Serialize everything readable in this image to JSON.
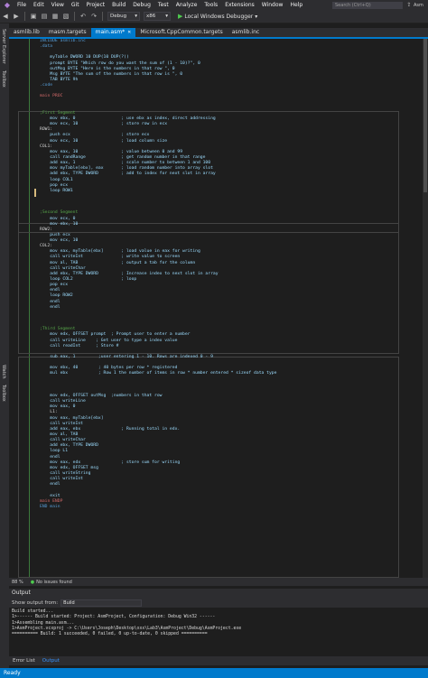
{
  "menu": {
    "items": [
      "File",
      "Edit",
      "View",
      "Git",
      "Project",
      "Build",
      "Debug",
      "Test",
      "Analyze",
      "Tools",
      "Extensions",
      "Window",
      "Help"
    ],
    "search_placeholder": "Search (Ctrl+Q)",
    "user": "Asm"
  },
  "toolbar": {
    "config": "Debug",
    "platform": "x86",
    "run_label": "Local Windows Debugger"
  },
  "sidebar": {
    "upper_tabs": [
      "Server Explorer",
      "Toolbox"
    ],
    "lower_tabs": [
      "Watch",
      "Toolbox"
    ]
  },
  "tabs": [
    {
      "label": "asmlib.lib",
      "active": false
    },
    {
      "label": "masm.targets",
      "active": false
    },
    {
      "label": "main.asm*",
      "active": true
    },
    {
      "label": "Microsoft.CppCommon.targets",
      "active": false
    },
    {
      "label": "asmlib.inc",
      "active": false
    }
  ],
  "code": [
    "INCLUDE asmlib.inc",
    ".data",
    "",
    "    myTable DWORD 10 DUP(10 DUP(?))",
    "    prompt BYTE \"Which row do you want the sum of (1 - 10)?\", 0",
    "    outMsg BYTE \"Here is the numbers in that row \", 0",
    "    Msg BYTE \"The sum of the numbers in that row is \", 0",
    "    TAB BYTE 9h",
    ".code",
    "",
    "main PROC",
    "",
    "",
    ";First Segment",
    "    mov ebx, 0                  ; use ebx as index, direct addressing",
    "    mov ecx, 10                 ; store row in ecx",
    "ROW1:",
    "    push ecx                    ; store ecx",
    "    mov ecx, 10                 ; load column size",
    "COL1:",
    "    mov eax, 10                 ; value between 0 and 99",
    "    call randRange              ; get random number in that range",
    "    add eax, 1                  ; scale number to between 1 and 100",
    "    mov myTable[ebx], eax       ; load random number into array slot",
    "    add ebx, TYPE DWORD         ; add to index for next slot in array",
    "    loop COL1",
    "    pop ecx",
    "    loop ROW1",
    "",
    "",
    "",
    ";Second Segment",
    "    mov ecx, 0",
    "    mov ebx, 10",
    "ROW2:",
    "    push ecx",
    "    mov ecx, 10",
    "COL2:",
    "    mov eax, myTable[ebx]       ; load value in eax for writing",
    "    call writeInt               ; write value to screen",
    "    mov al, TAB                 ; output a tab for the column",
    "    call writeChar",
    "    add ebx, TYPE DWORD         ; Increase index to next slot in array",
    "    loop COL2                   ; loop",
    "    pop ecx",
    "    endl",
    "    loop ROW2",
    "    endl",
    "    endl",
    "",
    "",
    "",
    ";Third Segment",
    "    mov edx, OFFSET prompt  ; Prompt user to enter a number",
    "    call writeLine    ; Get user to type a index value",
    "    call readInt      ; Store #",
    "",
    "    sub eax, 1         ;user entering 1 - 10. Rows are indexed 0 - 9",
    "",
    "    mov ebx, 40        ; 40 bytes per row * registered",
    "    mul ebx            ; Row 1 the number of items in row * number entered * sizeof data type",
    "",
    "",
    "",
    "    mov edx, OFFSET outMsg  ;numbers in that row",
    "    call writeLine",
    "    mov eax, 0",
    "    L1:",
    "    mov eax, myTable[ebx]",
    "    call writeInt",
    "    add eax, ebx                ; Running total in edx.",
    "    mov al, TAB",
    "    call writeChar",
    "    add ebx, TYPE DWORD",
    "    loop L1",
    "    endl",
    "    mov eax, edx                ; store sum for writing",
    "    mov edx, OFFSET msg",
    "    call writeString",
    "    call writeInt",
    "    endl",
    "",
    "    exit",
    "main ENDP",
    "END main"
  ],
  "editor_status": {
    "zoom": "88 %",
    "issues": "No issues found"
  },
  "output": {
    "title": "Output",
    "show_from_label": "Show output from:",
    "show_from_value": "Build",
    "lines": [
      "Build started...",
      "1>------ Build started: Project: AsmProject, Configuration: Debug Win32 ------",
      "1>Assembling main.asm...",
      "1>AsmProject.vcxproj -> C:\\Users\\Joseph\\Desktop\\xxx\\Lab3\\AsmProject\\Debug\\AsmProject.exe",
      "========== Build: 1 succeeded, 0 failed, 0 up-to-date, 0 skipped =========="
    ]
  },
  "bottom_tabs": [
    {
      "label": "Error List",
      "active": false
    },
    {
      "label": "Output",
      "active": true
    }
  ],
  "statusbar": {
    "text": "Ready"
  }
}
